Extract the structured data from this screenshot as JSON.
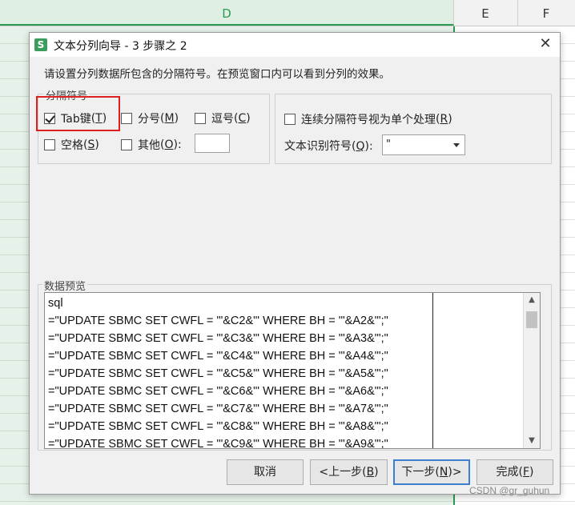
{
  "sheet": {
    "columns": [
      "D",
      "E",
      "F"
    ],
    "accent_color": "#2c9a52"
  },
  "dialog": {
    "icon_letter": "S",
    "title": "文本分列向导 - 3 步骤之 2",
    "close_glyph": "✕",
    "instruction": "请设置分列数据所包含的分隔符号。在预览窗口内可以看到分列的效果。",
    "delimiters": {
      "legend": "分隔符号",
      "tab": {
        "label": "Tab键",
        "key": "T",
        "checked": true
      },
      "semicolon": {
        "label": "分号",
        "key": "M",
        "checked": false
      },
      "comma": {
        "label": "逗号",
        "key": "C",
        "checked": false
      },
      "space": {
        "label": "空格",
        "key": "S",
        "checked": false
      },
      "other": {
        "label": "其他",
        "key": "O",
        "checked": false,
        "value": ""
      }
    },
    "options": {
      "consecutive": {
        "label": "连续分隔符号视为单个处理",
        "key": "R",
        "checked": false
      },
      "qualifier_label": "文本识别符号",
      "qualifier_key": "Q",
      "qualifier_value": "\""
    },
    "preview": {
      "legend": "数据预览",
      "lines": [
        "sql",
        "=\"UPDATE SBMC SET CWFL = '\"&C2&\"' WHERE BH = '\"&A2&\"';\"",
        "=\"UPDATE SBMC SET CWFL = '\"&C3&\"' WHERE BH = '\"&A3&\"';\"",
        "=\"UPDATE SBMC SET CWFL = '\"&C4&\"' WHERE BH = '\"&A4&\"';\"",
        "=\"UPDATE SBMC SET CWFL = '\"&C5&\"' WHERE BH = '\"&A5&\"';\"",
        "=\"UPDATE SBMC SET CWFL = '\"&C6&\"' WHERE BH = '\"&A6&\"';\"",
        "=\"UPDATE SBMC SET CWFL = '\"&C7&\"' WHERE BH = '\"&A7&\"';\"",
        "=\"UPDATE SBMC SET CWFL = '\"&C8&\"' WHERE BH = '\"&A8&\"';\"",
        "=\"UPDATE SBMC SET CWFL = '\"&C9&\"' WHERE BH = '\"&A9&\"';\""
      ]
    },
    "buttons": {
      "cancel": "取消",
      "back": "<上一步(",
      "back_key": "B",
      "back_end": ")",
      "next": "下一步(",
      "next_key": "N",
      "next_end": ")>",
      "finish": "完成(",
      "finish_key": "F",
      "finish_end": ")"
    }
  },
  "watermark": "CSDN @gr_guhun"
}
